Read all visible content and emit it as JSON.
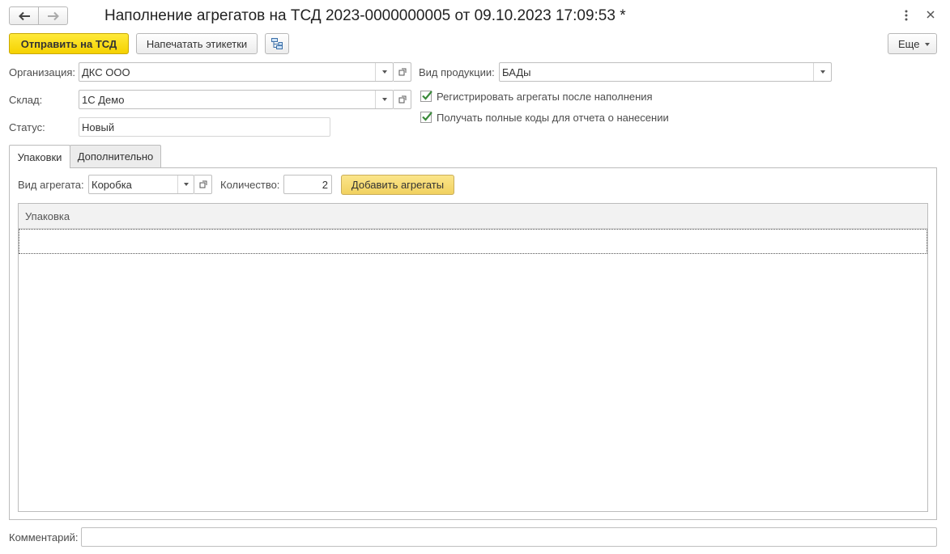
{
  "header": {
    "title": "Наполнение агрегатов на ТСД 2023-0000000005 от 09.10.2023 17:09:53 *",
    "nav_back_icon": "arrow-left-icon",
    "nav_forward_icon": "arrow-right-icon",
    "more_icon": "vertical-dots-icon",
    "close_icon": "close-icon"
  },
  "toolbar": {
    "send_label": "Отправить на ТСД",
    "print_label": "Напечатать этикетки",
    "structure_icon": "structure-icon",
    "more_label": "Еще"
  },
  "form": {
    "organization_label": "Организация:",
    "organization_value": "ДКС ООО",
    "warehouse_label": "Склад:",
    "warehouse_value": "1С Демо",
    "status_label": "Статус:",
    "status_value": "Новый",
    "product_type_label": "Вид продукции:",
    "product_type_value": "БАДы",
    "register_label": "Регистрировать агрегаты после наполнения",
    "register_checked": true,
    "full_codes_label": "Получать полные коды для отчета о нанесении",
    "full_codes_checked": true
  },
  "tabs": [
    {
      "label": "Упаковки",
      "active": true
    },
    {
      "label": "Дополнительно",
      "active": false
    }
  ],
  "packaging": {
    "aggregate_type_label": "Вид агрегата:",
    "aggregate_type_value": "Коробка",
    "quantity_label": "Количество:",
    "quantity_value": "2",
    "add_button_label": "Добавить агрегаты",
    "table": {
      "columns": [
        "Упаковка"
      ],
      "rows": [
        [
          ""
        ]
      ]
    }
  },
  "footer": {
    "comment_label": "Комментарий:",
    "comment_value": ""
  },
  "colors": {
    "primary_button": "#f5d100",
    "add_button": "#f1d160",
    "checkmark": "#3a8a3a",
    "border": "#bfbfbf"
  }
}
